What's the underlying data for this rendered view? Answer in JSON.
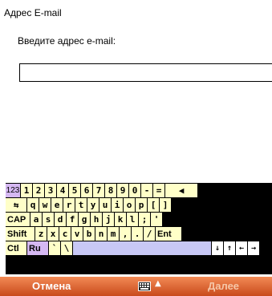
{
  "form": {
    "section_title": "Адрес E-mail",
    "prompt": "Введите адрес e-mail:",
    "email_value": ""
  },
  "keyboard": {
    "row1": [
      "123",
      "1",
      "2",
      "3",
      "4",
      "5",
      "6",
      "7",
      "8",
      "9",
      "0",
      "-",
      "=",
      "◀"
    ],
    "row2": [
      "⇆",
      "q",
      "w",
      "e",
      "r",
      "t",
      "y",
      "u",
      "i",
      "o",
      "p",
      "[",
      "]"
    ],
    "row3": [
      "CAP",
      "a",
      "s",
      "d",
      "f",
      "g",
      "h",
      "j",
      "k",
      "l",
      ";",
      "'"
    ],
    "row4": [
      "Shift",
      "z",
      "x",
      "c",
      "v",
      "b",
      "n",
      "m",
      ",",
      ".",
      "/",
      "Ent"
    ],
    "row5": [
      "Ctl",
      "Ru",
      "`",
      "\\",
      "",
      "↓",
      "↑",
      "←",
      "→"
    ]
  },
  "softkeys": {
    "left_label": "Отмена",
    "right_label": "Далее",
    "input_panel_icon": "keyboard-icon",
    "input_panel_arrow": "▲"
  }
}
